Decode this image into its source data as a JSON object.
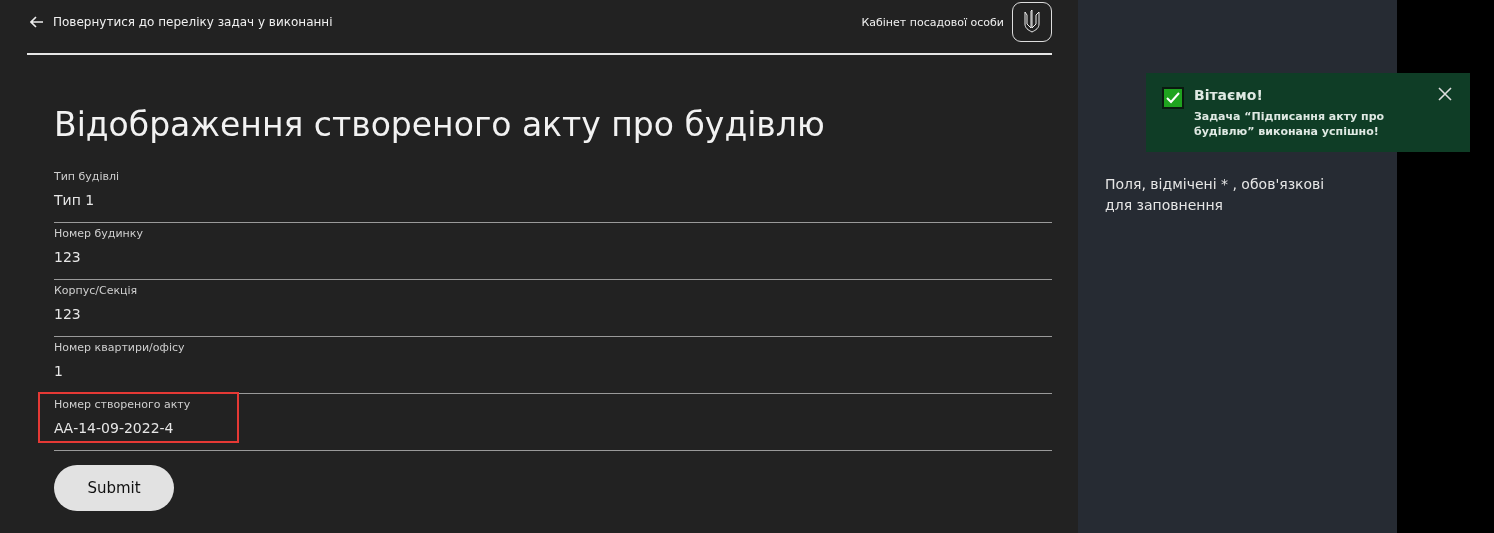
{
  "header": {
    "back_link": "Повернутися до переліку задач у виконанні",
    "cabinet": "Кабінет посадової особи"
  },
  "title": "Відображення створеного акту про будівлю",
  "fields": [
    {
      "label": "Тип будівлі",
      "value": "Тип 1",
      "highlighted": false
    },
    {
      "label": "Номер будинку",
      "value": "123",
      "highlighted": false
    },
    {
      "label": "Корпус/Секція",
      "value": "123",
      "highlighted": false
    },
    {
      "label": "Номер квартири/офісу",
      "value": "1",
      "highlighted": false
    },
    {
      "label": "Номер створеного акту",
      "value": "АА-14-09-2022-4",
      "highlighted": true
    }
  ],
  "submit": "Submit",
  "sidebar": {
    "note": "Поля, відмічені * , обов'язкові для заповнення"
  },
  "toast": {
    "title": "Вітаємо!",
    "message": "Задача “Підписання акту про будівлю” виконана успішно!",
    "checked": true
  }
}
